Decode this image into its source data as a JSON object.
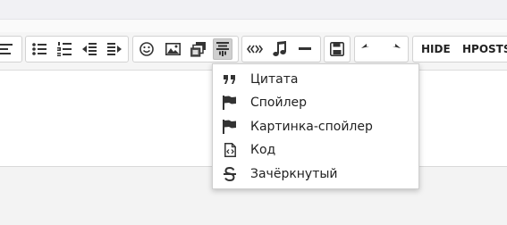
{
  "toolbar": {
    "buttons": [
      {
        "name": "align-left-icon"
      },
      {
        "name": "bullet-list-icon"
      },
      {
        "name": "numbered-list-icon"
      },
      {
        "name": "outdent-icon"
      },
      {
        "name": "indent-icon"
      },
      {
        "name": "smiley-icon"
      },
      {
        "name": "image-icon"
      },
      {
        "name": "gallery-icon"
      },
      {
        "name": "paragraph-format-icon"
      },
      {
        "name": "quote-marks-icon"
      },
      {
        "name": "music-icon"
      },
      {
        "name": "horizontal-line-icon"
      },
      {
        "name": "save-icon"
      },
      {
        "name": "undo-icon"
      },
      {
        "name": "redo-icon"
      }
    ],
    "hide_label": "HIDE",
    "hposts_label": "HPOSTS"
  },
  "dropdown": {
    "items": [
      {
        "label": "Цитата",
        "icon": "quote-icon"
      },
      {
        "label": "Спойлер",
        "icon": "flag-icon"
      },
      {
        "label": "Картинка-спойлер",
        "icon": "flag-icon"
      },
      {
        "label": "Код",
        "icon": "code-file-icon"
      },
      {
        "label": "Зачёркнутый",
        "icon": "strikethrough-icon"
      }
    ]
  },
  "colors": {
    "toolbar_bg": "#f5f5f5",
    "active_button": "#cfcfcf",
    "icon": "#333333"
  }
}
